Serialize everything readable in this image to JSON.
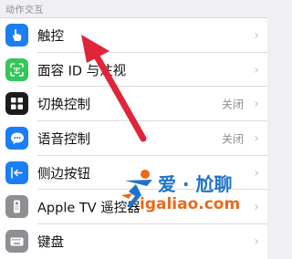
{
  "section": {
    "header": "动作交互"
  },
  "rows": [
    {
      "label": "触控",
      "value": "",
      "icon": "hand-touch-icon",
      "color": "#1a7ef5"
    },
    {
      "label": "面容 ID 与注视",
      "value": "",
      "icon": "face-id-icon",
      "color": "#34c759"
    },
    {
      "label": "切换控制",
      "value": "关闭",
      "icon": "switch-control-icon",
      "color": "#1c1c1e"
    },
    {
      "label": "语音控制",
      "value": "关闭",
      "icon": "voice-control-icon",
      "color": "#1a7ef5"
    },
    {
      "label": "侧边按钮",
      "value": "",
      "icon": "side-button-icon",
      "color": "#1a7ef5"
    },
    {
      "label": "Apple TV 遥控器",
      "value": "",
      "icon": "remote-icon",
      "color": "#8e8e93"
    },
    {
      "label": "键盘",
      "value": "",
      "icon": "keyboard-icon",
      "color": "#8e8e93"
    }
  ],
  "chevron": "›",
  "watermark": {
    "title": "爱 · 尬聊",
    "url": "igaliao.com"
  },
  "colors": {
    "arrow": "#e0243a",
    "watermark_blue": "#1e73c8",
    "watermark_orange": "#e86a1b"
  }
}
